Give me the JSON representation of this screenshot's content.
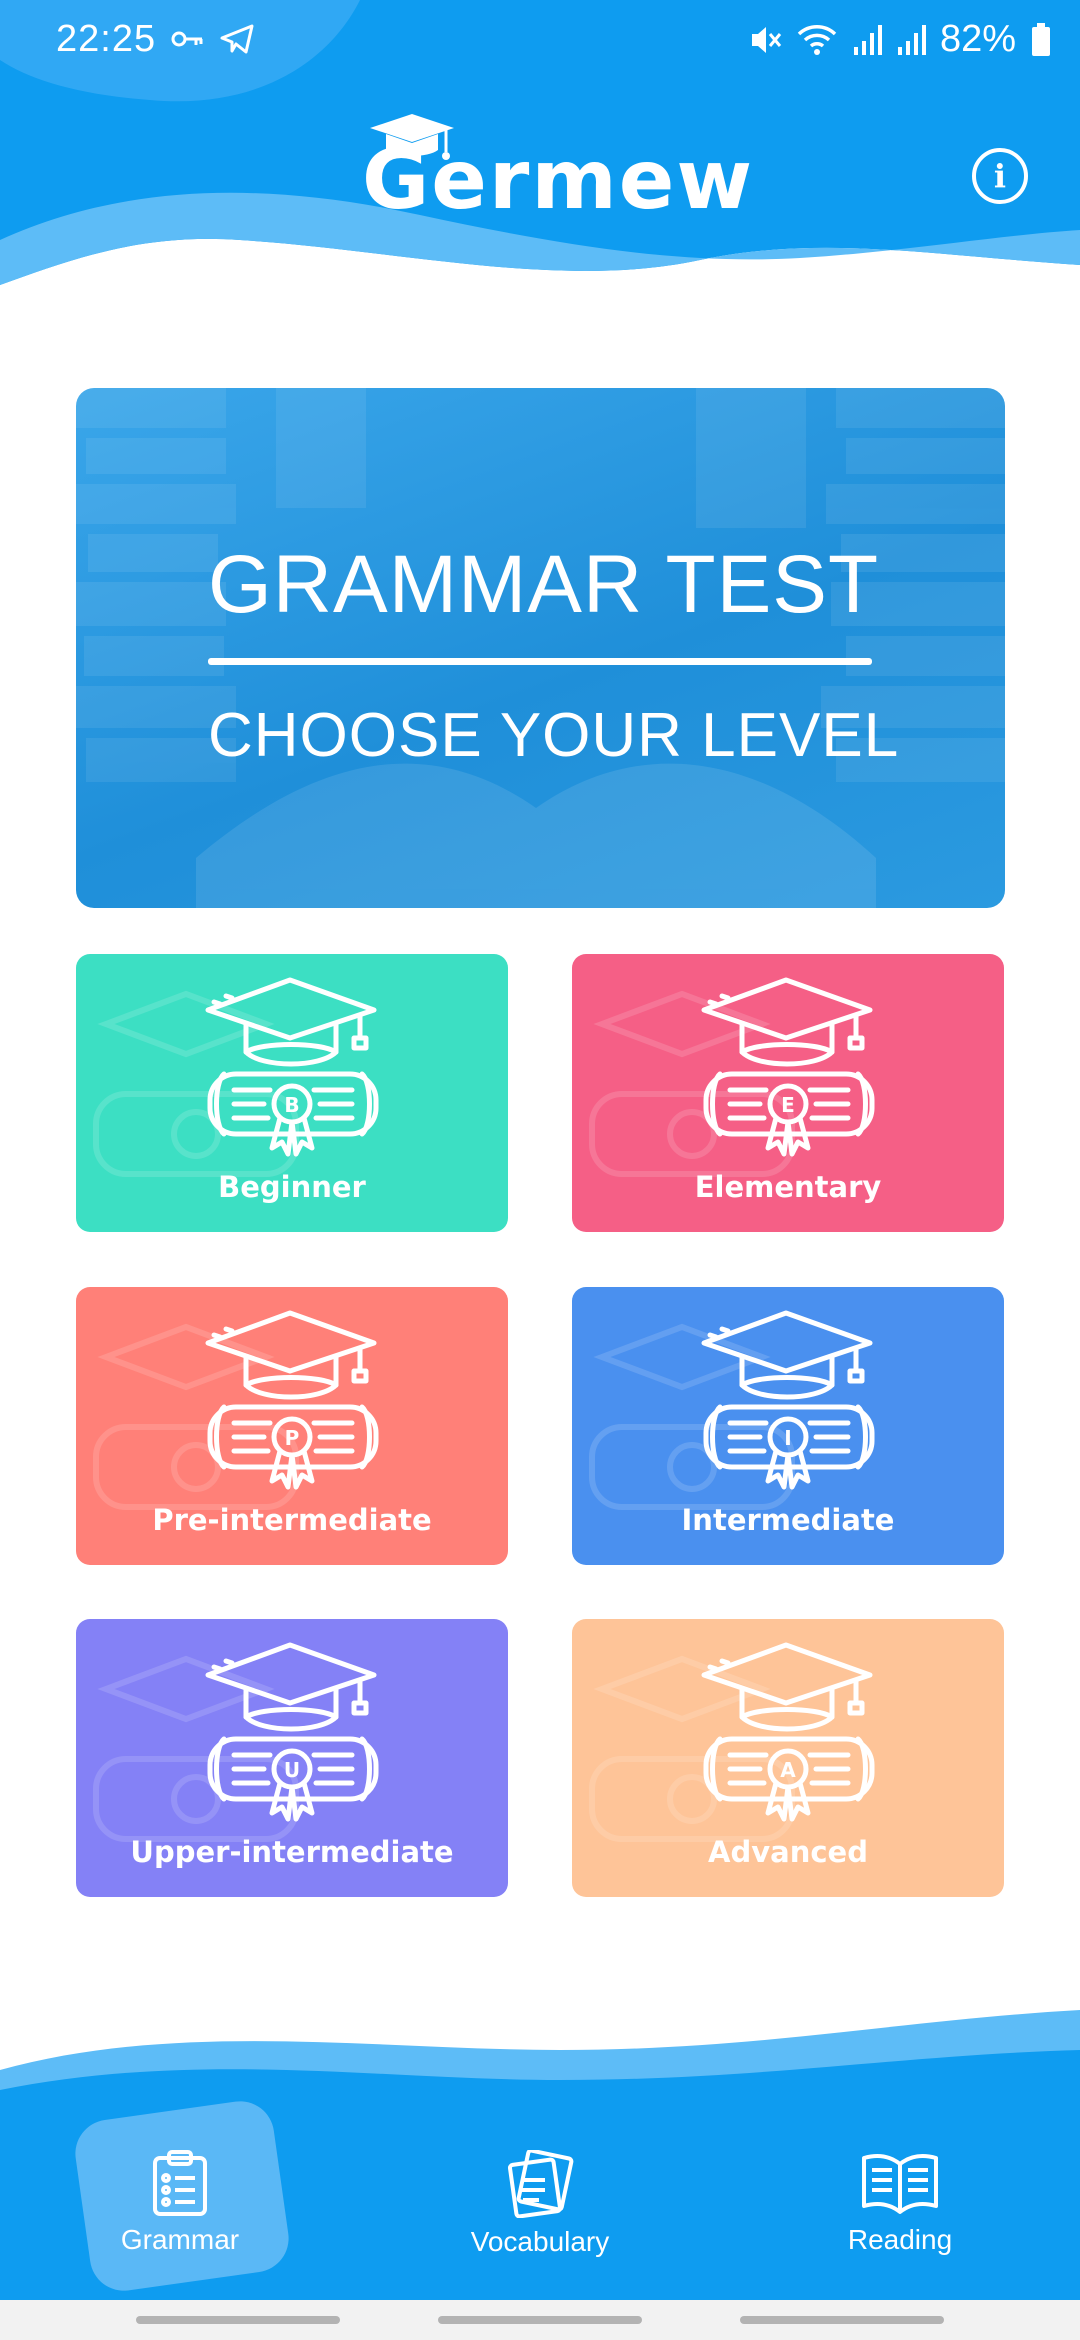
{
  "status_bar": {
    "time": "22:25",
    "battery": "82%",
    "icons": [
      "key-icon",
      "telegram-icon",
      "mute-icon",
      "wifi-icon",
      "signal-icon",
      "signal-icon",
      "battery-icon"
    ]
  },
  "app": {
    "name": "Germew",
    "info_icon": "info-icon",
    "accent_color": "#0e9cf0"
  },
  "banner": {
    "title": "GRAMMAR TEST",
    "subtitle": "CHOOSE YOUR LEVEL"
  },
  "levels": [
    {
      "label": "Beginner",
      "badge": "B",
      "color": "#3cdfc3"
    },
    {
      "label": "Elementary",
      "badge": "E",
      "color": "#f55f86"
    },
    {
      "label": "Pre-intermediate",
      "badge": "P",
      "color": "#ff8078"
    },
    {
      "label": "Intermediate",
      "badge": "I",
      "color": "#4a90ef"
    },
    {
      "label": "Upper-intermediate",
      "badge": "U",
      "color": "#8481f6"
    },
    {
      "label": "Advanced",
      "badge": "A",
      "color": "#fec498"
    }
  ],
  "nav": {
    "grammar": {
      "label": "Grammar",
      "icon": "clipboard-icon",
      "active": true
    },
    "vocabulary": {
      "label": "Vocabulary",
      "icon": "cards-icon"
    },
    "reading": {
      "label": "Reading",
      "icon": "book-icon"
    }
  }
}
